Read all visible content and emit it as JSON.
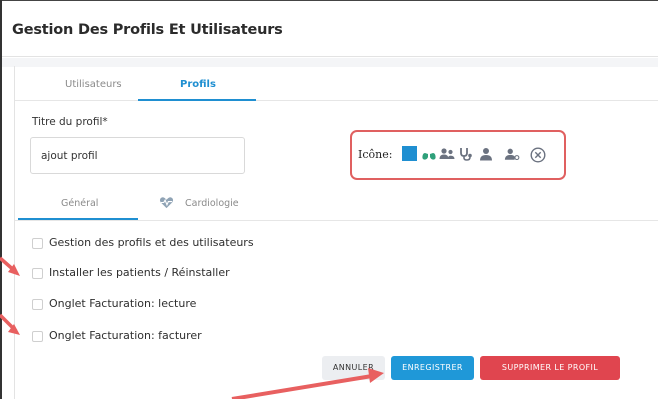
{
  "modal": {
    "title": "Gestion Des Profils Et Utilisateurs"
  },
  "tabs": [
    {
      "label": "Utilisateurs",
      "active": false
    },
    {
      "label": "Profils",
      "active": true
    }
  ],
  "profile_form": {
    "title_label": "Titre du profil*",
    "title_value": "ajout profil",
    "icon_label": "Icône:",
    "icons": [
      "blue-square-icon",
      "lungs-icon",
      "users-icon",
      "stethoscope-icon",
      "user-icon",
      "user-settings-icon",
      "close-circle-icon"
    ]
  },
  "sub_tabs": [
    {
      "label": "Général",
      "active": true,
      "icon": ""
    },
    {
      "label": "Cardiologie",
      "active": false,
      "icon": "heart-pulse-icon"
    }
  ],
  "permissions": [
    {
      "label": "Gestion des profils et des utilisateurs",
      "checked": false
    },
    {
      "label": "Installer les patients / Réinstaller",
      "checked": false
    },
    {
      "label": "Onglet Facturation: lecture",
      "checked": false
    },
    {
      "label": "Onglet Facturation: facturer",
      "checked": false
    }
  ],
  "buttons": {
    "cancel": "ANNULER",
    "save": "ENREGISTRER",
    "delete": "SUPPRIMER LE PROFIL"
  },
  "colors": {
    "accent": "#1f98d8",
    "danger": "#e0454f",
    "annotation": "#e86060",
    "icon_gray": "#6b7280"
  }
}
